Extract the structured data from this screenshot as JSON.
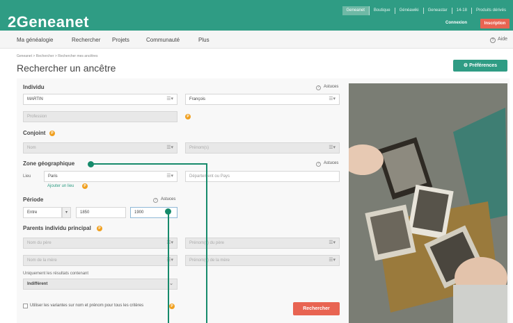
{
  "header": {
    "logo": "2Geneanet",
    "links": [
      "Geneanet",
      "Boutique",
      "Généawiki",
      "Geneastar",
      "14-18",
      "Produits dérivés"
    ],
    "connexion": "Connexion",
    "inscription": "Inscription"
  },
  "nav": {
    "items": [
      "Ma généalogie",
      "Rechercher",
      "Projets",
      "Communauté",
      "Plus"
    ],
    "aide": "Aide"
  },
  "breadcrumb": "Geneanet > Rechercher > Rechercher mes ancêtres",
  "page_title": "Rechercher un ancêtre",
  "preferences_button": "Préférences",
  "form": {
    "individu": {
      "section": "Individu",
      "astuces": "Astuces",
      "nom": "MARTIN",
      "prenom": "François",
      "profession_placeholder": "Profession"
    },
    "conjoint": {
      "section": "Conjoint",
      "nom_placeholder": "Nom",
      "prenom_placeholder": "Prénom(s)"
    },
    "zone": {
      "section": "Zone géographique",
      "astuces": "Astuces",
      "lieu_label": "Lieu",
      "lieu_value": "Paris",
      "region_placeholder": "Département ou Pays",
      "add_place": "Ajouter un lieu"
    },
    "periode": {
      "section": "Période",
      "astuces": "Astuces",
      "mode": "Entre",
      "from": "1850",
      "to": "1900"
    },
    "parents": {
      "section": "Parents individu principal",
      "pere_nom": "Nom du père",
      "pere_prenom": "Prénom(s) du père",
      "mere_nom": "Nom de la mère",
      "mere_prenom": "Prénom(s) de la mère"
    },
    "results_label": "Uniquement les résultats contenant",
    "results_value": "Indifférent",
    "variantes": "Utiliser les variantes sur nom et prénom pour tous les critères",
    "submit": "Rechercher"
  },
  "colors": {
    "brand": "#2f9c84",
    "accent": "#e86452",
    "callout": "#168a6b"
  }
}
